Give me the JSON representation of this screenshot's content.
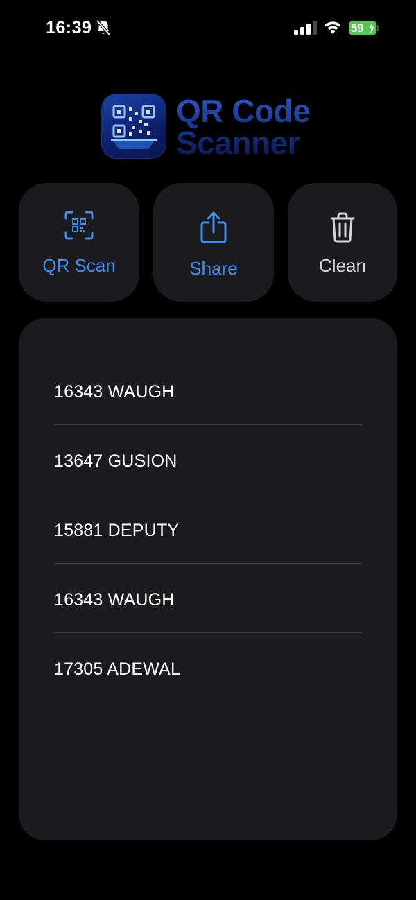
{
  "status_bar": {
    "time": "16:39",
    "battery_level": "59",
    "icons": [
      "bell-slash-icon",
      "cellular-signal-icon",
      "wifi-icon",
      "battery-charging-icon"
    ]
  },
  "app": {
    "title_line1": "QR Code",
    "title_line2": "Scanner",
    "logo_icon": "qr-scanner-logo-icon"
  },
  "actions": {
    "scan": {
      "label": "QR Scan",
      "icon": "qr-scan-icon",
      "color": "#3b8ff0"
    },
    "share": {
      "label": "Share",
      "icon": "share-icon",
      "color": "#3b8ff0"
    },
    "clean": {
      "label": "Clean",
      "icon": "trash-icon",
      "color": "#d6d6d8"
    }
  },
  "history": {
    "items": [
      "16343 WAUGH",
      "13647 GUSION",
      "15881 DEPUTY",
      "16343 WAUGH",
      "17305 ADEWAL"
    ]
  },
  "colors": {
    "background": "#000000",
    "card": "#1c1c1e",
    "accent": "#3b8ff0",
    "battery": "#59c653"
  }
}
